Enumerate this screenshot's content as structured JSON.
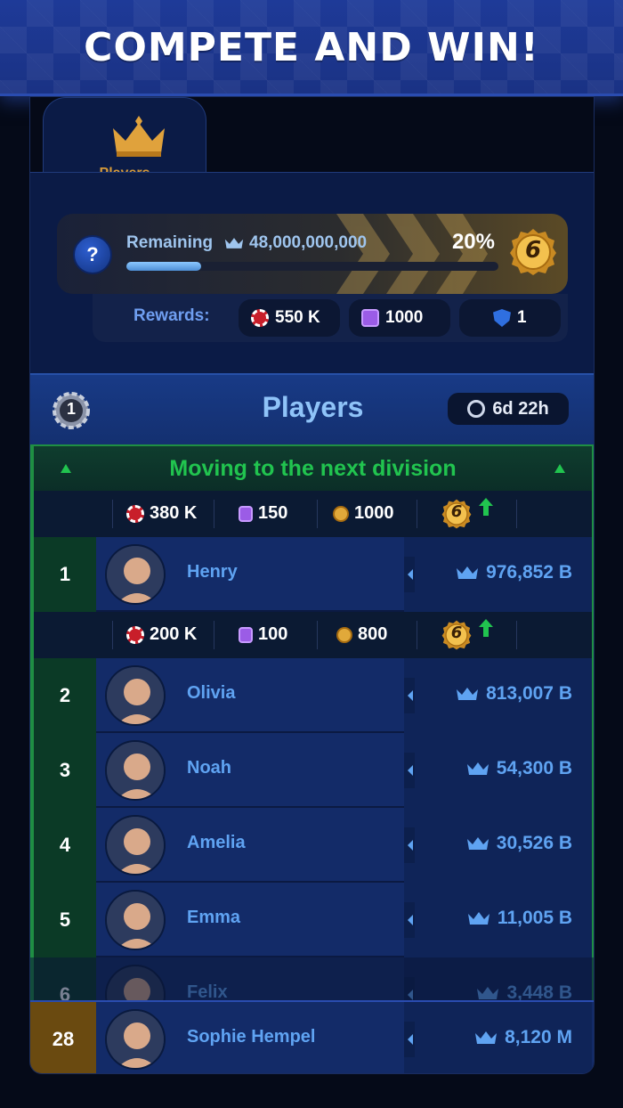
{
  "banner": {
    "title": "COMPETE AND WIN!"
  },
  "tab": {
    "label": "Players",
    "icon": "crown-icon"
  },
  "progress": {
    "remaining_label": "Remaining",
    "remaining_value": "48,000,000,000",
    "percent_text": "20%",
    "fill_fraction": 0.2,
    "division_badge": "6",
    "help_label": "?"
  },
  "rewards": {
    "label": "Rewards:",
    "chips": "550 K",
    "tickets": "1000",
    "shields": "1"
  },
  "header": {
    "title": "Players",
    "timer": "6d 22h",
    "rank_badge": "1"
  },
  "next_division": {
    "text": "Moving to the next division"
  },
  "reward_tiers": [
    {
      "chips": "380 K",
      "tickets": "150",
      "coins": "1000",
      "badge": "6"
    },
    {
      "chips": "200 K",
      "tickets": "100",
      "coins": "800",
      "badge": "6"
    }
  ],
  "players": [
    {
      "rank": "1",
      "name": "Henry",
      "score": "976,852 B"
    },
    {
      "rank": "2",
      "name": "Olivia",
      "score": "813,007 B"
    },
    {
      "rank": "3",
      "name": "Noah",
      "score": "54,300 B"
    },
    {
      "rank": "4",
      "name": "Amelia",
      "score": "30,526 B"
    },
    {
      "rank": "5",
      "name": "Emma",
      "score": "11,005 B"
    },
    {
      "rank": "6",
      "name": "Felix",
      "score": "3,448 B"
    }
  ],
  "me": {
    "rank": "28",
    "name": "Sophie Hempel",
    "score": "8,120 M"
  },
  "colors": {
    "accent_blue": "#5fa3f2",
    "promotion_green": "#21c44f",
    "gold": "#e1a93a"
  }
}
